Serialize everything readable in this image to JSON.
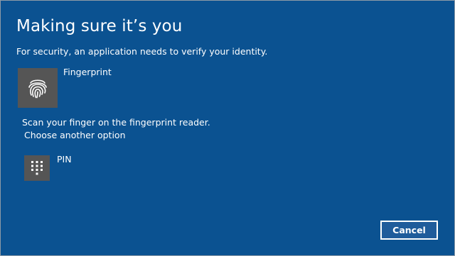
{
  "dialog": {
    "title": "Making sure it’s you",
    "subtitle": "For security, an application needs to verify your identity.",
    "fingerprint": {
      "label": "Fingerprint",
      "icon": "fingerprint-icon",
      "instruction": "Scan your finger on the fingerprint reader."
    },
    "choose_another": "Choose another option",
    "pin": {
      "label": "PIN",
      "icon": "keypad-icon"
    },
    "cancel_label": "Cancel"
  },
  "colors": {
    "background": "#0b5291",
    "tile": "#555555",
    "text": "#ffffff",
    "button_border": "#ffffff"
  }
}
